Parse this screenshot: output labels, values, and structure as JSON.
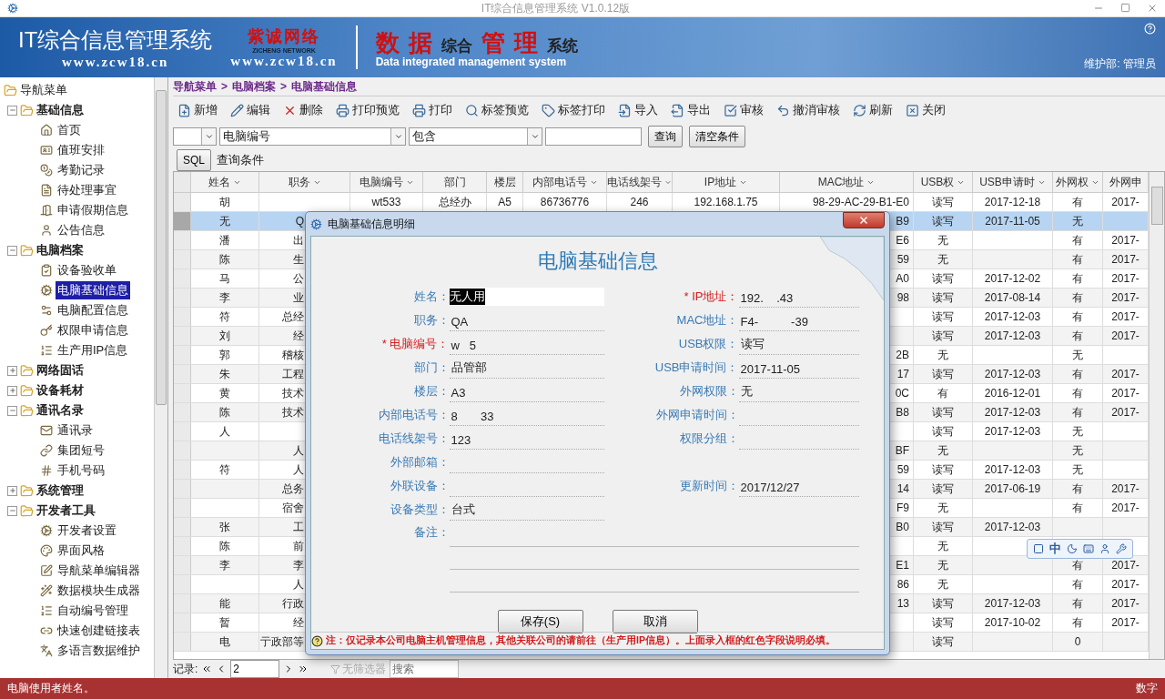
{
  "window": {
    "title": "IT综合信息管理系统 V1.0.12版"
  },
  "banner": {
    "app_name": "IT综合信息管理系统",
    "app_url": "www.zcw18.cn",
    "logo_name": "紫诚网络",
    "logo_sub": "ZICHENG NETWORK",
    "logo_url": "www.zcw18.cn",
    "slogan_parts": [
      "数",
      "据",
      "综合",
      "管",
      "理",
      "系统"
    ],
    "slogan_en": "Data integrated management system",
    "user": "维护部: 管理员"
  },
  "sidebar": {
    "root": "导航菜单",
    "groups": [
      {
        "label": "基础信息",
        "expanded": true,
        "children": [
          {
            "label": "首页",
            "selected": false
          },
          {
            "label": "值班安排",
            "selected": false
          },
          {
            "label": "考勤记录",
            "selected": false
          },
          {
            "label": "待处理事宜",
            "selected": false
          },
          {
            "label": "申请假期信息",
            "selected": false
          },
          {
            "label": "公告信息",
            "selected": false
          }
        ]
      },
      {
        "label": "电脑档案",
        "expanded": true,
        "children": [
          {
            "label": "设备验收单",
            "selected": false
          },
          {
            "label": "电脑基础信息",
            "selected": true
          },
          {
            "label": "电脑配置信息",
            "selected": false
          },
          {
            "label": "权限申请信息",
            "selected": false
          },
          {
            "label": "生产用IP信息",
            "selected": false
          }
        ]
      },
      {
        "label": "网络固话",
        "expanded": false
      },
      {
        "label": "设备耗材",
        "expanded": false
      },
      {
        "label": "通讯名录",
        "expanded": true,
        "children": [
          {
            "label": "通讯录",
            "selected": false
          },
          {
            "label": "集团短号",
            "selected": false
          },
          {
            "label": "手机号码",
            "selected": false
          }
        ]
      },
      {
        "label": "系统管理",
        "expanded": false
      },
      {
        "label": "开发者工具",
        "expanded": true,
        "children": [
          {
            "label": "开发者设置",
            "selected": false
          },
          {
            "label": "界面风格",
            "selected": false
          },
          {
            "label": "导航菜单编辑器",
            "selected": false
          },
          {
            "label": "数据模块生成器",
            "selected": false
          },
          {
            "label": "自动编号管理",
            "selected": false
          },
          {
            "label": "快速创建链接表",
            "selected": false
          },
          {
            "label": "多语言数据维护",
            "selected": false
          }
        ]
      }
    ]
  },
  "breadcrumb": {
    "separator": ">",
    "items": [
      "导航菜单",
      "电脑档案",
      "电脑基础信息"
    ]
  },
  "toolbar": [
    "新增",
    "编辑",
    "删除",
    "打印预览",
    "打印",
    "标签预览",
    "标签打印",
    "导入",
    "导出",
    "审核",
    "撤消审核",
    "刷新",
    "关闭"
  ],
  "filter": {
    "field": "电脑编号",
    "operator": "包含",
    "query_button": "查询",
    "clear_button": "清空条件",
    "sql_button": "SQL",
    "condition_label": "查询条件"
  },
  "table": {
    "columns": [
      "姓名",
      "职务",
      "电脑编号",
      "部门",
      "楼层",
      "内部电话号",
      "电话线架号",
      "IP地址",
      "MAC地址",
      "USB权",
      "USB申请时",
      "外网权",
      "外网申"
    ],
    "rows": [
      {
        "selected": false,
        "cells": [
          "胡",
          null,
          "wt533",
          "总经办",
          "A5",
          "86736776",
          "246",
          "192.168.1.75",
          "98-29-AC-29-B1-E0",
          "读写",
          "2017-12-18",
          "有",
          "2017-"
        ]
      },
      {
        "selected": true,
        "cells": [
          "无",
          "Q",
          null,
          null,
          null,
          null,
          null,
          null,
          "B9",
          "读写",
          "2017-11-05",
          "无",
          null
        ]
      },
      {
        "selected": false,
        "cells": [
          "潘",
          "出",
          null,
          null,
          null,
          null,
          null,
          null,
          "E6",
          "无",
          null,
          "有",
          "2017-"
        ]
      },
      {
        "selected": false,
        "cells": [
          "陈",
          "生",
          null,
          null,
          null,
          null,
          null,
          null,
          "59",
          "无",
          null,
          "有",
          "2017-"
        ]
      },
      {
        "selected": false,
        "cells": [
          "马",
          "公",
          null,
          null,
          null,
          null,
          null,
          null,
          "A0",
          "读写",
          "2017-12-02",
          "有",
          "2017-"
        ]
      },
      {
        "selected": false,
        "cells": [
          "李",
          "业",
          null,
          null,
          null,
          null,
          null,
          null,
          "98",
          "读写",
          "2017-08-14",
          "有",
          "2017-"
        ]
      },
      {
        "selected": false,
        "cells": [
          "符",
          "总经",
          null,
          null,
          null,
          null,
          null,
          null,
          null,
          "读写",
          "2017-12-03",
          "有",
          "2017-"
        ]
      },
      {
        "selected": false,
        "cells": [
          "刘",
          "经",
          null,
          null,
          null,
          null,
          null,
          null,
          null,
          "读写",
          "2017-12-03",
          "有",
          "2017-"
        ]
      },
      {
        "selected": false,
        "cells": [
          "郭",
          "稽核",
          null,
          null,
          null,
          null,
          null,
          null,
          "2B",
          "无",
          null,
          "无",
          null
        ]
      },
      {
        "selected": false,
        "cells": [
          "朱",
          "工程",
          null,
          null,
          null,
          null,
          null,
          null,
          "17",
          "读写",
          "2017-12-03",
          "有",
          "2017-"
        ]
      },
      {
        "selected": false,
        "cells": [
          "黄",
          "技术",
          null,
          null,
          null,
          null,
          null,
          null,
          "0C",
          "有",
          "2016-12-01",
          "有",
          "2017-"
        ]
      },
      {
        "selected": false,
        "cells": [
          "陈",
          "技术",
          null,
          null,
          null,
          null,
          null,
          null,
          "B8",
          "读写",
          "2017-12-03",
          "有",
          "2017-"
        ]
      },
      {
        "selected": false,
        "cells": [
          "人",
          null,
          null,
          null,
          null,
          null,
          null,
          null,
          null,
          "读写",
          "2017-12-03",
          "无",
          null
        ]
      },
      {
        "selected": false,
        "cells": [
          null,
          "人",
          null,
          null,
          null,
          null,
          null,
          null,
          "BF",
          "无",
          null,
          "无",
          null
        ]
      },
      {
        "selected": false,
        "cells": [
          "符",
          "人",
          null,
          null,
          null,
          null,
          null,
          null,
          "59",
          "读写",
          "2017-12-03",
          "无",
          null
        ]
      },
      {
        "selected": false,
        "cells": [
          null,
          "总务",
          null,
          null,
          null,
          null,
          null,
          null,
          "14",
          "读写",
          "2017-06-19",
          "有",
          "2017-"
        ]
      },
      {
        "selected": false,
        "cells": [
          null,
          "宿舍",
          null,
          null,
          null,
          null,
          null,
          null,
          "F9",
          "无",
          null,
          "有",
          "2017-"
        ]
      },
      {
        "selected": false,
        "cells": [
          "张",
          "工",
          null,
          null,
          null,
          null,
          null,
          null,
          "B0",
          "读写",
          "2017-12-03",
          null,
          null
        ]
      },
      {
        "selected": false,
        "cells": [
          "陈",
          "前",
          null,
          null,
          null,
          null,
          null,
          null,
          null,
          "无",
          null,
          null,
          null
        ]
      },
      {
        "selected": false,
        "cells": [
          "李",
          "李",
          null,
          null,
          null,
          null,
          null,
          null,
          "E1",
          "无",
          null,
          "有",
          "2017-"
        ]
      },
      {
        "selected": false,
        "cells": [
          null,
          "人",
          null,
          null,
          null,
          null,
          null,
          null,
          "86",
          "无",
          null,
          "有",
          "2017-"
        ]
      },
      {
        "selected": false,
        "cells": [
          "能",
          "行政",
          null,
          null,
          null,
          null,
          null,
          null,
          "13",
          "读写",
          "2017-12-03",
          "有",
          "2017-"
        ]
      },
      {
        "selected": false,
        "cells": [
          "暂",
          "经",
          null,
          null,
          null,
          null,
          null,
          null,
          null,
          "读写",
          "2017-10-02",
          "有",
          "2017-"
        ]
      },
      {
        "selected": false,
        "cells": [
          "电",
          "亍政部等",
          null,
          null,
          null,
          null,
          null,
          null,
          null,
          "读写",
          null,
          "0",
          null
        ]
      }
    ]
  },
  "pager": {
    "label": "记录:",
    "page": "2",
    "filter_state": "无筛选器",
    "search": {
      "placeholder": "搜索"
    }
  },
  "status_bar": {
    "message": "电脑使用者姓名。",
    "mode": "数字"
  },
  "ime_bar": {
    "label": "中"
  },
  "dialog": {
    "title": "电脑基础信息明细",
    "heading": "电脑基础信息",
    "rows": [
      {
        "left": {
          "label": "姓名：",
          "value": "无人用",
          "required": false,
          "kind": "input"
        },
        "right": {
          "label": "* IP地址：",
          "value": "192.    .43",
          "required": true,
          "kind": "line"
        }
      },
      {
        "left": {
          "label": "职务：",
          "value": "QA",
          "required": false,
          "kind": "line"
        },
        "right": {
          "label": "MAC地址：",
          "value": "F4-          -39",
          "required": false,
          "kind": "line"
        }
      },
      {
        "left": {
          "label": "* 电脑编号：",
          "value": "w   5",
          "required": true,
          "kind": "line"
        },
        "right": {
          "label": "USB权限：",
          "value": "读写",
          "required": false,
          "kind": "line"
        }
      },
      {
        "left": {
          "label": "部门：",
          "value": "品管部",
          "required": false,
          "kind": "line"
        },
        "right": {
          "label": "USB申请时间：",
          "value": "2017-11-05",
          "required": false,
          "kind": "line"
        }
      },
      {
        "left": {
          "label": "楼层：",
          "value": "A3",
          "required": false,
          "kind": "line"
        },
        "right": {
          "label": "外网权限：",
          "value": "无",
          "required": false,
          "kind": "line"
        }
      },
      {
        "left": {
          "label": "内部电话号：",
          "value": "8       33",
          "required": false,
          "kind": "line"
        },
        "right": {
          "label": "外网申请时间：",
          "required": false,
          "kind": "line"
        }
      },
      {
        "left": {
          "label": "电话线架号：",
          "value": "123",
          "required": false,
          "kind": "line"
        },
        "right": {
          "label": "权限分组：",
          "required": false,
          "kind": "line"
        }
      },
      {
        "left": {
          "label": "外部邮箱：",
          "required": false,
          "kind": "line"
        }
      },
      {
        "left": {
          "label": "外联设备：",
          "required": false,
          "kind": "line"
        },
        "right": {
          "label": "更新时间：",
          "value": "2017/12/27",
          "required": false,
          "kind": "line"
        }
      },
      {
        "left": {
          "label": "设备类型：",
          "value": "台式",
          "required": false,
          "kind": "line"
        }
      },
      {
        "left": {
          "label": "备注：",
          "required": false,
          "kind": "memo"
        }
      }
    ],
    "buttons": [
      "保存(S)",
      "取消"
    ],
    "note": "注：仅记录本公司电脑主机管理信息，其他关联公司的请前往（生产用IP信息）。上面录入框的红色字段说明必填。"
  }
}
